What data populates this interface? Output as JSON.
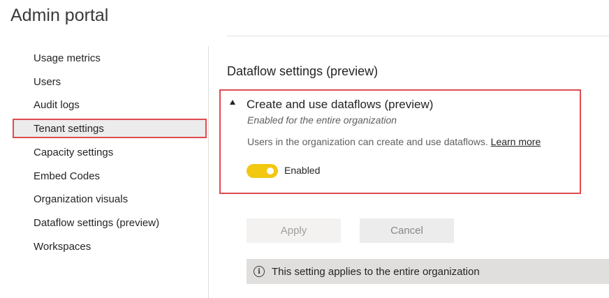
{
  "app": {
    "title": "Admin portal"
  },
  "sidebar": {
    "items": [
      {
        "label": "Usage metrics"
      },
      {
        "label": "Users"
      },
      {
        "label": "Audit logs"
      },
      {
        "label": "Tenant settings",
        "selected": true
      },
      {
        "label": "Capacity settings"
      },
      {
        "label": "Embed Codes"
      },
      {
        "label": "Organization visuals"
      },
      {
        "label": "Dataflow settings (preview)"
      },
      {
        "label": "Workspaces"
      }
    ]
  },
  "main": {
    "section_title": "Dataflow settings (preview)",
    "setting": {
      "name": "Create and use dataflows (preview)",
      "status": "Enabled for the entire organization",
      "description": "Users in the organization can create and use dataflows.",
      "learn_more": "Learn more",
      "toggle_label": "Enabled",
      "toggle_on": true
    },
    "buttons": {
      "apply": "Apply",
      "cancel": "Cancel"
    },
    "info": {
      "icon": "info-icon",
      "text": "This setting applies to the entire organization"
    }
  },
  "colors": {
    "highlight_border": "#e04b4f",
    "toggle_on": "#f2c811",
    "selected_bg": "#ececec",
    "info_bg": "#e1dfdd"
  }
}
